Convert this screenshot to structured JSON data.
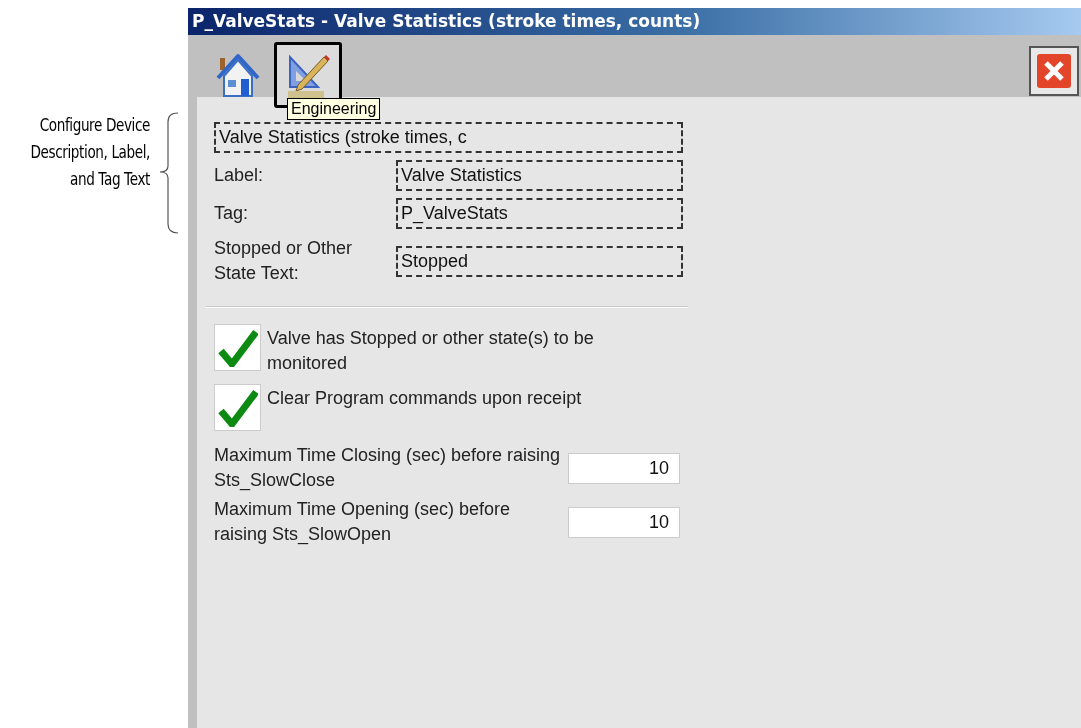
{
  "annotation": {
    "text": "Configure Device Description, Label, and Tag Text"
  },
  "window": {
    "title": "P_ValveStats - Valve Statistics (stroke times, counts)"
  },
  "toolbar": [
    {
      "kind": "home",
      "selected": false
    },
    {
      "kind": "engineering",
      "selected": true
    }
  ],
  "tooltip": "Engineering",
  "description": {
    "value": "Valve Statistics (stroke times, c"
  },
  "text_fields": [
    {
      "label": "Label:",
      "value": "Valve Statistics"
    },
    {
      "label": "Tag:",
      "value": "P_ValveStats"
    },
    {
      "label": "Stopped or Other State Text:",
      "value": "Stopped"
    }
  ],
  "checkboxes": [
    {
      "label": "Valve has Stopped or other state(s) to be monitored",
      "checked": true
    },
    {
      "label": "Clear Program commands upon receipt",
      "checked": true
    }
  ],
  "number_fields": [
    {
      "label": "Maximum Time Closing (sec) before raising Sts_SlowClose",
      "value": "10"
    },
    {
      "label": "Maximum Time Opening (sec) before raising Sts_SlowOpen",
      "value": "10"
    }
  ]
}
